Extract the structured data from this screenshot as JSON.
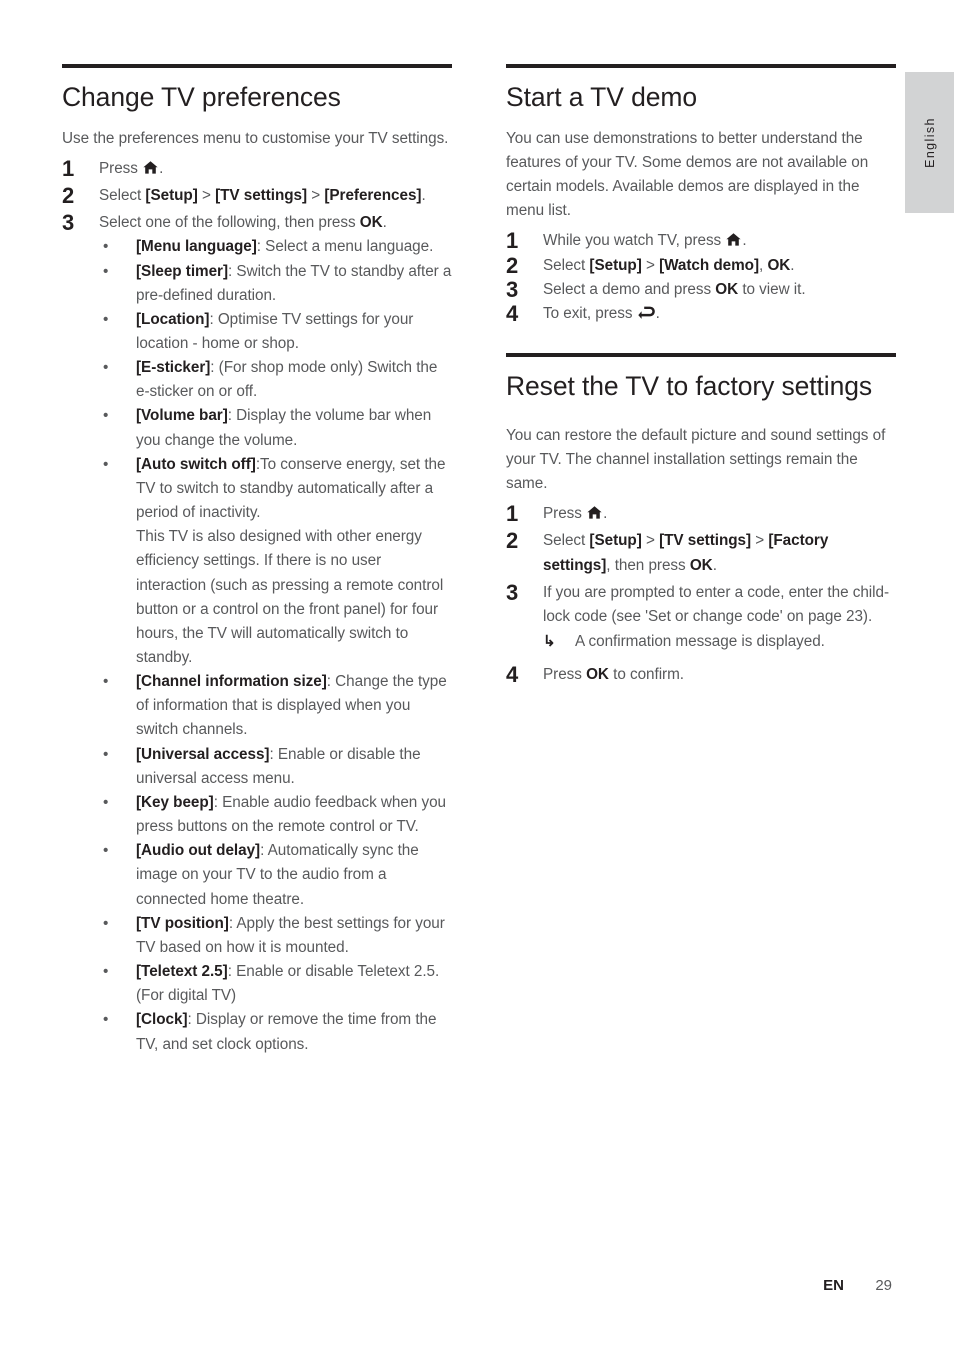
{
  "page": {
    "language_tab": "English",
    "footer_lang_code": "EN",
    "footer_page_number": "29"
  },
  "left_column": {
    "title": "Change TV preferences",
    "intro": "Use the preferences menu to customise your TV settings.",
    "steps": [
      {
        "num": "1",
        "text_before": "Press ",
        "text_after": "."
      },
      {
        "num": "2",
        "text": "Select [Setup] > [TV settings] > [Preferences]."
      },
      {
        "num": "3",
        "text": "Select one of the following, then press OK."
      }
    ],
    "step1_label": "Press",
    "step2_prefix": "Select ",
    "step2_setup": "[Setup]",
    "step2_gt1": " > ",
    "step2_tvsettings": "[TV settings]",
    "step2_gt2": " > ",
    "step2_preferences": "[Preferences]",
    "step2_suffix": ".",
    "step3_prefix": "Select one of the following, then press ",
    "step3_ok": "OK",
    "step3_suffix": ".",
    "bullets": [
      {
        "term": "[Menu language]",
        "desc": ": Select a menu language."
      },
      {
        "term": "[Sleep timer]",
        "desc": ": Switch the TV to standby after a pre-defined duration."
      },
      {
        "term": "[Location]",
        "desc": ": Optimise TV settings for your location - home or shop."
      },
      {
        "term": "[E-sticker]",
        "desc": ": (For shop mode only) Switch the e-sticker on or off."
      },
      {
        "term": "[Volume bar]",
        "desc": ": Display the volume bar when you change the volume."
      },
      {
        "term": "[Auto switch off]",
        "desc": ":To conserve energy, set the TV to switch to standby automatically after a period of inactivity.",
        "continuation": "This TV is also designed with other energy efficiency settings. If there is no user interaction (such as pressing a remote control button or a control on the front panel) for four hours, the TV will automatically switch to standby."
      },
      {
        "term": "[Channel information size]",
        "desc": ": Change the type of information that is displayed when you switch channels."
      },
      {
        "term": "[Universal access]",
        "desc": ": Enable or disable the universal access menu."
      },
      {
        "term": "[Key beep]",
        "desc": ": Enable audio feedback when you press buttons on the remote control or TV."
      },
      {
        "term": "[Audio out delay]",
        "desc": ": Automatically sync the image on your TV to the audio from a connected home theatre."
      },
      {
        "term": "[TV position]",
        "desc": ": Apply the best settings for your TV based on how it is mounted."
      },
      {
        "term": "[Teletext 2.5]",
        "desc": ": Enable or disable Teletext 2.5. (For digital TV)"
      },
      {
        "term": "[Clock]",
        "desc": ": Display or remove the time from the TV, and set clock options."
      }
    ]
  },
  "right_column": {
    "demo": {
      "title": "Start a TV demo",
      "intro": "You can use demonstrations to better understand the features of your TV. Some demos are not available on certain models. Available demos are displayed in the menu list.",
      "step1_prefix": "While you watch TV, press ",
      "step1_suffix": ".",
      "step1_num": "1",
      "step2_num": "2",
      "step2_prefix": "Select ",
      "step2_setup": "[Setup]",
      "step2_gt": " > ",
      "step2_watchdemo": "[Watch demo]",
      "step2_comma": ", ",
      "step2_ok": "OK",
      "step2_suffix": ".",
      "step3_num": "3",
      "step3_prefix": "Select a demo and press ",
      "step3_ok": "OK",
      "step3_suffix": " to view it.",
      "step4_num": "4",
      "step4_prefix": "To exit, press ",
      "step4_suffix": "."
    },
    "reset": {
      "title": "Reset the TV to factory settings",
      "intro": "You can restore the default picture and sound settings of your TV. The channel installation settings remain the same.",
      "step1_num": "1",
      "step1_prefix": "Press ",
      "step1_suffix": ".",
      "step2_num": "2",
      "step2_prefix": "Select ",
      "step2_setup": "[Setup]",
      "step2_gt1": " > ",
      "step2_tvsettings": "[TV settings]",
      "step2_gt2": " > ",
      "step2_factory": "[Factory settings]",
      "step2_mid": ", then press ",
      "step2_ok": "OK",
      "step2_suffix": ".",
      "step3_num": "3",
      "step3_text": "If you are prompted to enter a code, enter the child-lock code (see 'Set or change code' on page 23).",
      "step3_note": "A confirmation message is displayed.",
      "step4_num": "4",
      "step4_prefix": "Press ",
      "step4_ok": "OK",
      "step4_suffix": " to confirm."
    }
  },
  "icons": {
    "home": "home-icon",
    "back": "back-arrow-icon",
    "note_arrow": "corner-arrow-icon"
  }
}
